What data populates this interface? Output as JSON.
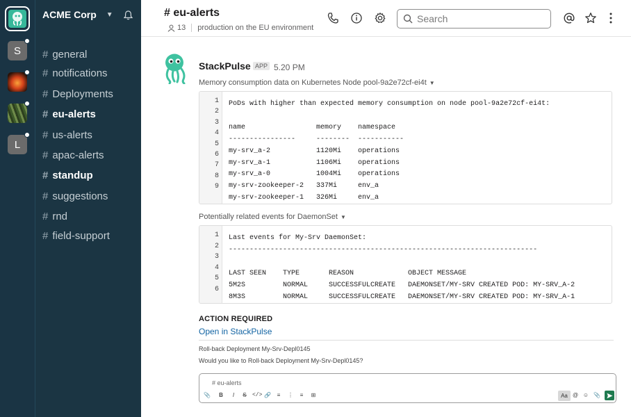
{
  "workspace": {
    "name": "ACME Corp",
    "rail": [
      {
        "letter": "",
        "icon": "stackpulse-logo-icon"
      },
      {
        "letter": "S"
      },
      {
        "letter": "",
        "icon": "fire-avatar-icon"
      },
      {
        "letter": "",
        "icon": "forest-avatar-icon"
      },
      {
        "letter": "L"
      }
    ]
  },
  "sidebar": {
    "channels": [
      {
        "label": "general",
        "bold": false
      },
      {
        "label": "notifications",
        "bold": false
      },
      {
        "label": "Deployments",
        "bold": false
      },
      {
        "label": "eu-alerts",
        "bold": true
      },
      {
        "label": "us-alerts",
        "bold": false
      },
      {
        "label": "apac-alerts",
        "bold": false
      },
      {
        "label": "standup",
        "bold": true
      },
      {
        "label": "suggestions",
        "bold": false
      },
      {
        "label": "rnd",
        "bold": false
      },
      {
        "label": "field-support",
        "bold": false
      }
    ],
    "hash": "#"
  },
  "header": {
    "title": "# eu-alerts",
    "member_count": "13",
    "topic": "production on the EU environment",
    "search_placeholder": "Search"
  },
  "message": {
    "sender": "StackPulse",
    "badge": "APP",
    "time": "5.20 PM",
    "section1_title": "Memory consumption data on Kubernetes Node pool-9a2e72cf-ei4t",
    "section1_lines": [
      "PoDs with higher than expected memory consumption on node pool-9a2e72cf-ei4t:",
      "",
      "name                 memory    namespace",
      "----------------     --------  -----------",
      "my-srv_a-2           1120Mi    operations",
      "my-srv_a-1           1106Mi    operations",
      "my-srv_a-0           1004Mi    operations",
      "my-srv-zookeeper-2   337Mi     env_a",
      "my-srv-zookeeper-1   326Mi     env_a"
    ],
    "section1_line_numbers": [
      "1",
      "2",
      "3",
      "4",
      "5",
      "6",
      "7",
      "8",
      "9"
    ],
    "section2_title": "Potentially related events for DaemonSet",
    "section2_lines": [
      "Last events for My-Srv DaemonSet:",
      "--------------------------------------------------------------------------",
      "",
      "LAST SEEN    TYPE       REASON             OBJECT MESSAGE",
      "5M2S         NORMAL     SUCCESSFULCREATE   DAEMONSET/MY-SRV CREATED POD: MY-SRV_A-2",
      "8M3S         NORMAL     SUCCESSFULCREATE   DAEMONSET/MY-SRV CREATED POD: MY-SRV_A-1"
    ],
    "section2_line_numbers": [
      "1",
      "2",
      "3",
      "4",
      "5",
      "6"
    ],
    "action_required": "ACTION REQUIRED",
    "open_link": "Open in StackPulse",
    "rollback_title": "Roll-back Deployment My-Srv-Depl0145",
    "rollback_question": "Would you like to Roll-back Deployment My-Srv-Depl0145?"
  },
  "composer": {
    "placeholder": "# eu-alerts",
    "aa_label": "Aa"
  },
  "colors": {
    "sidebar_bg": "#1b3543",
    "rail_bg": "#1a3444",
    "accent_green": "#37b89a",
    "link_blue": "#1264a3"
  }
}
